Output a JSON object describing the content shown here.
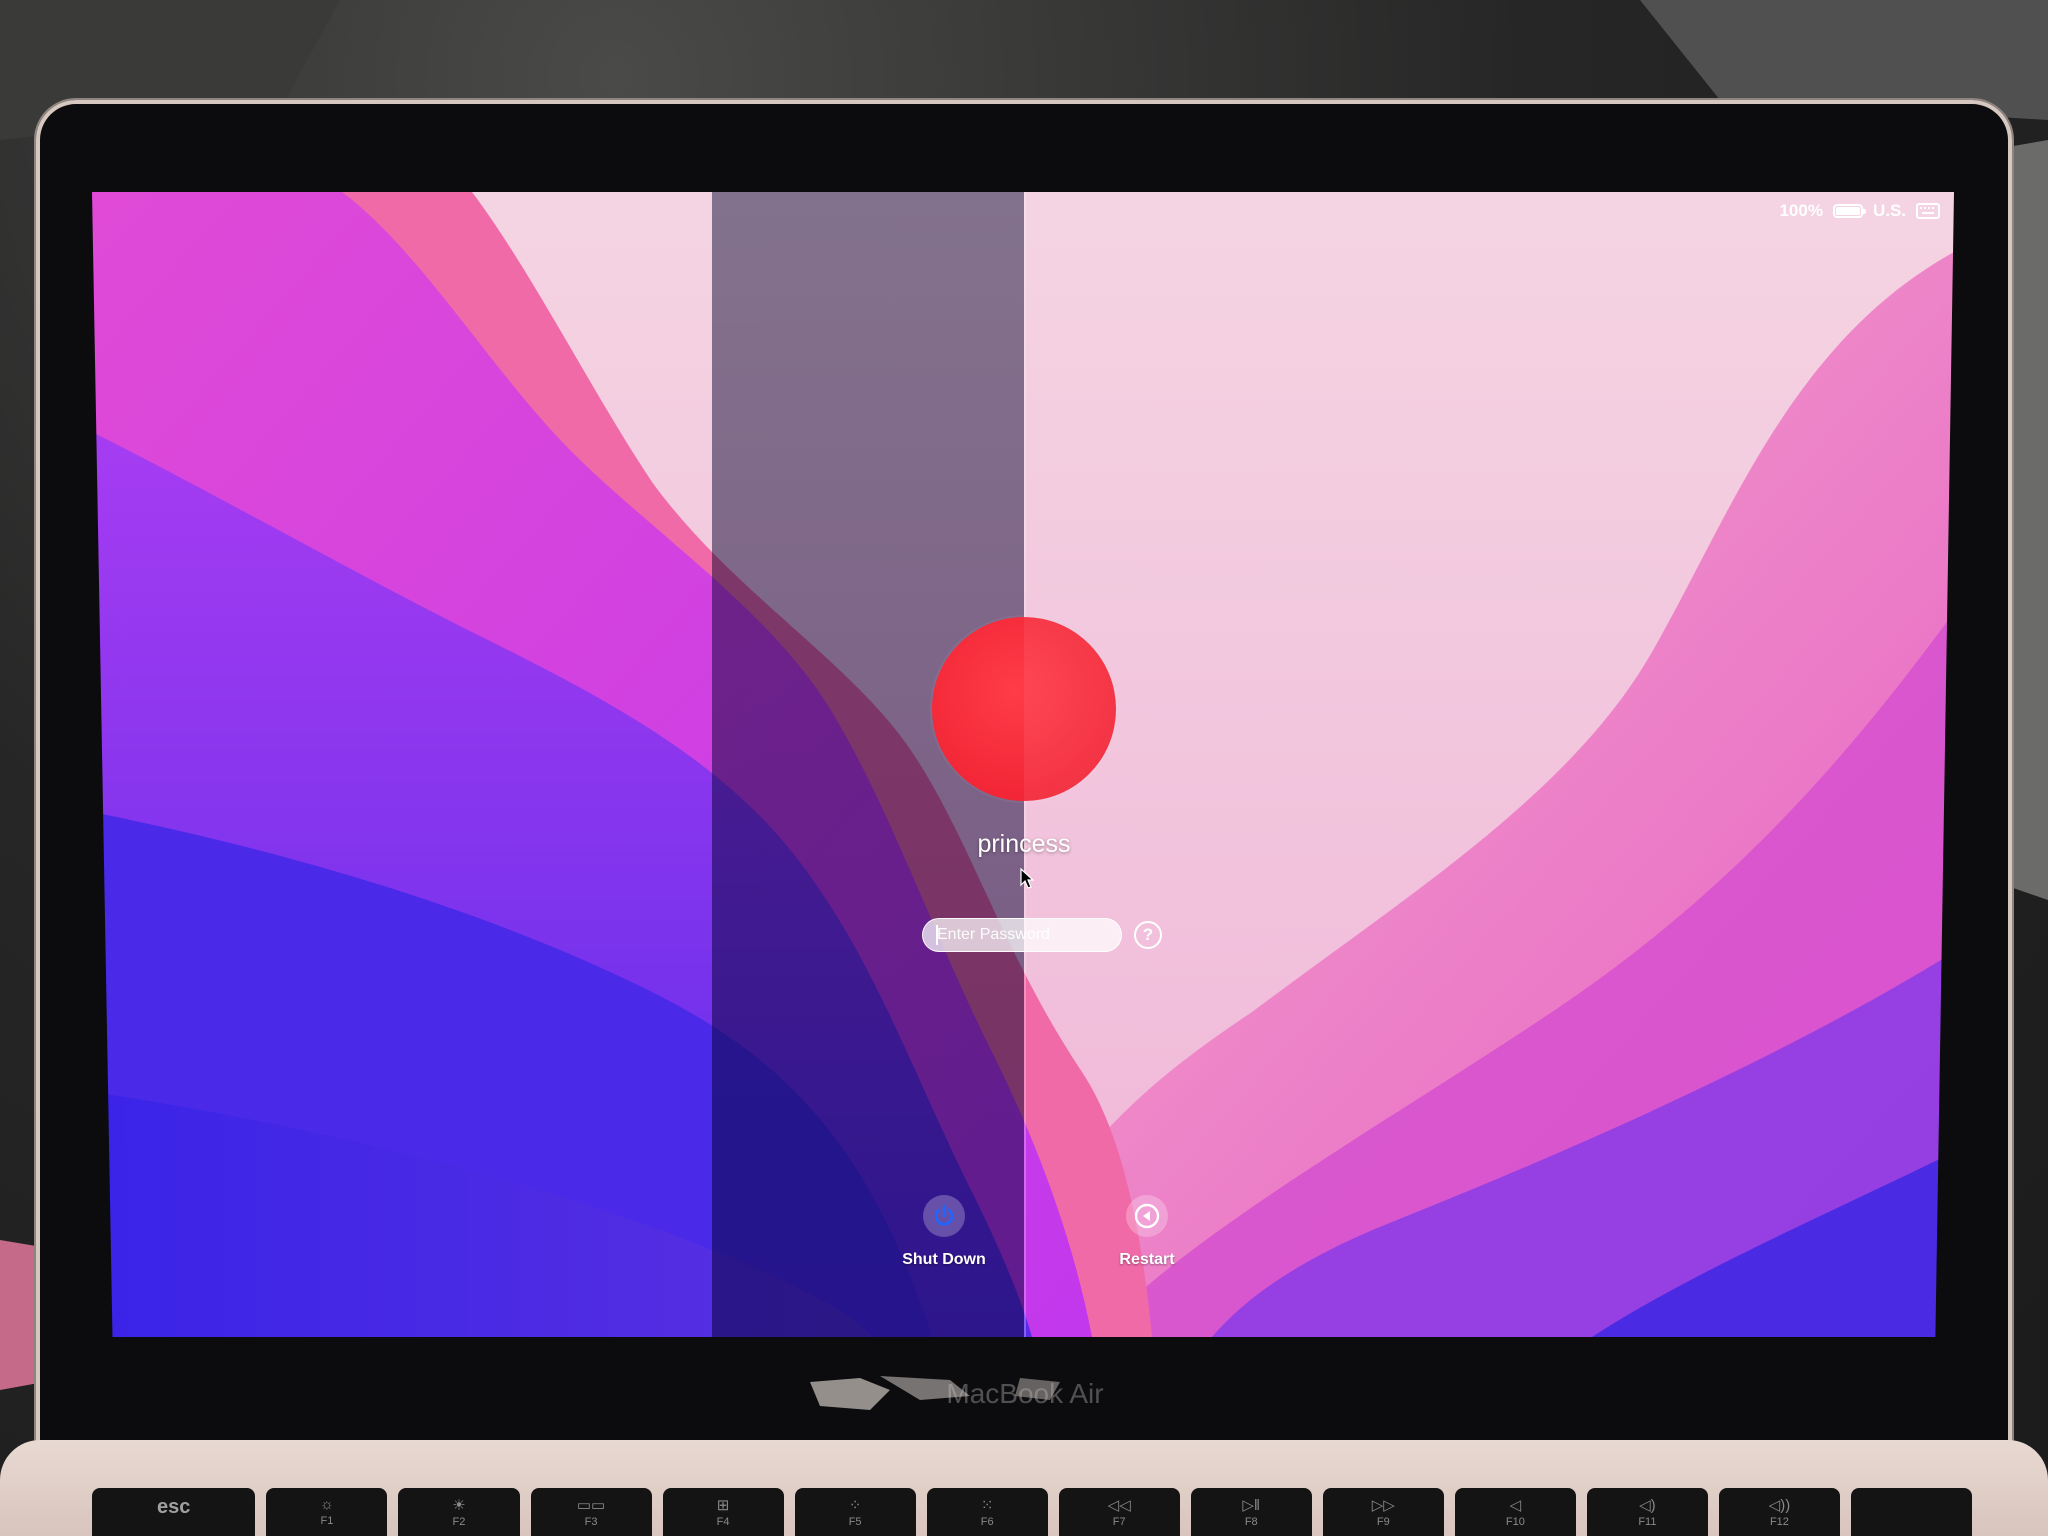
{
  "status_bar": {
    "battery_percent": "100%",
    "input_source": "U.S.",
    "battery_icon": "battery-full-icon",
    "keyboard_icon": "keyboard-icon"
  },
  "login": {
    "avatar_color": "#f22636",
    "user_name": "princess",
    "password_placeholder": "Enter Password",
    "help_label": "?"
  },
  "actions": {
    "shut_down": {
      "label": "Shut Down",
      "icon": "power-icon"
    },
    "restart": {
      "label": "Restart",
      "icon": "restart-icon"
    }
  },
  "device": {
    "model_label": "MacBook Air"
  },
  "keyboard": {
    "keys": [
      {
        "label": "esc",
        "sub": ""
      },
      {
        "label": "☼",
        "sub": "F1"
      },
      {
        "label": "☀",
        "sub": "F2"
      },
      {
        "label": "▭▭",
        "sub": "F3"
      },
      {
        "label": "⊞",
        "sub": "F4"
      },
      {
        "label": "⁘",
        "sub": "F5"
      },
      {
        "label": "⁙",
        "sub": "F6"
      },
      {
        "label": "◁◁",
        "sub": "F7"
      },
      {
        "label": "▷‖",
        "sub": "F8"
      },
      {
        "label": "▷▷",
        "sub": "F9"
      },
      {
        "label": "◁",
        "sub": "F10"
      },
      {
        "label": "◁)",
        "sub": "F11"
      },
      {
        "label": "◁))",
        "sub": "F12"
      },
      {
        "label": "",
        "sub": ""
      }
    ]
  },
  "colors": {
    "wallpaper_pink": "#e23fd0",
    "wallpaper_blue": "#3320e0",
    "wallpaper_light": "#f6d8e4"
  }
}
